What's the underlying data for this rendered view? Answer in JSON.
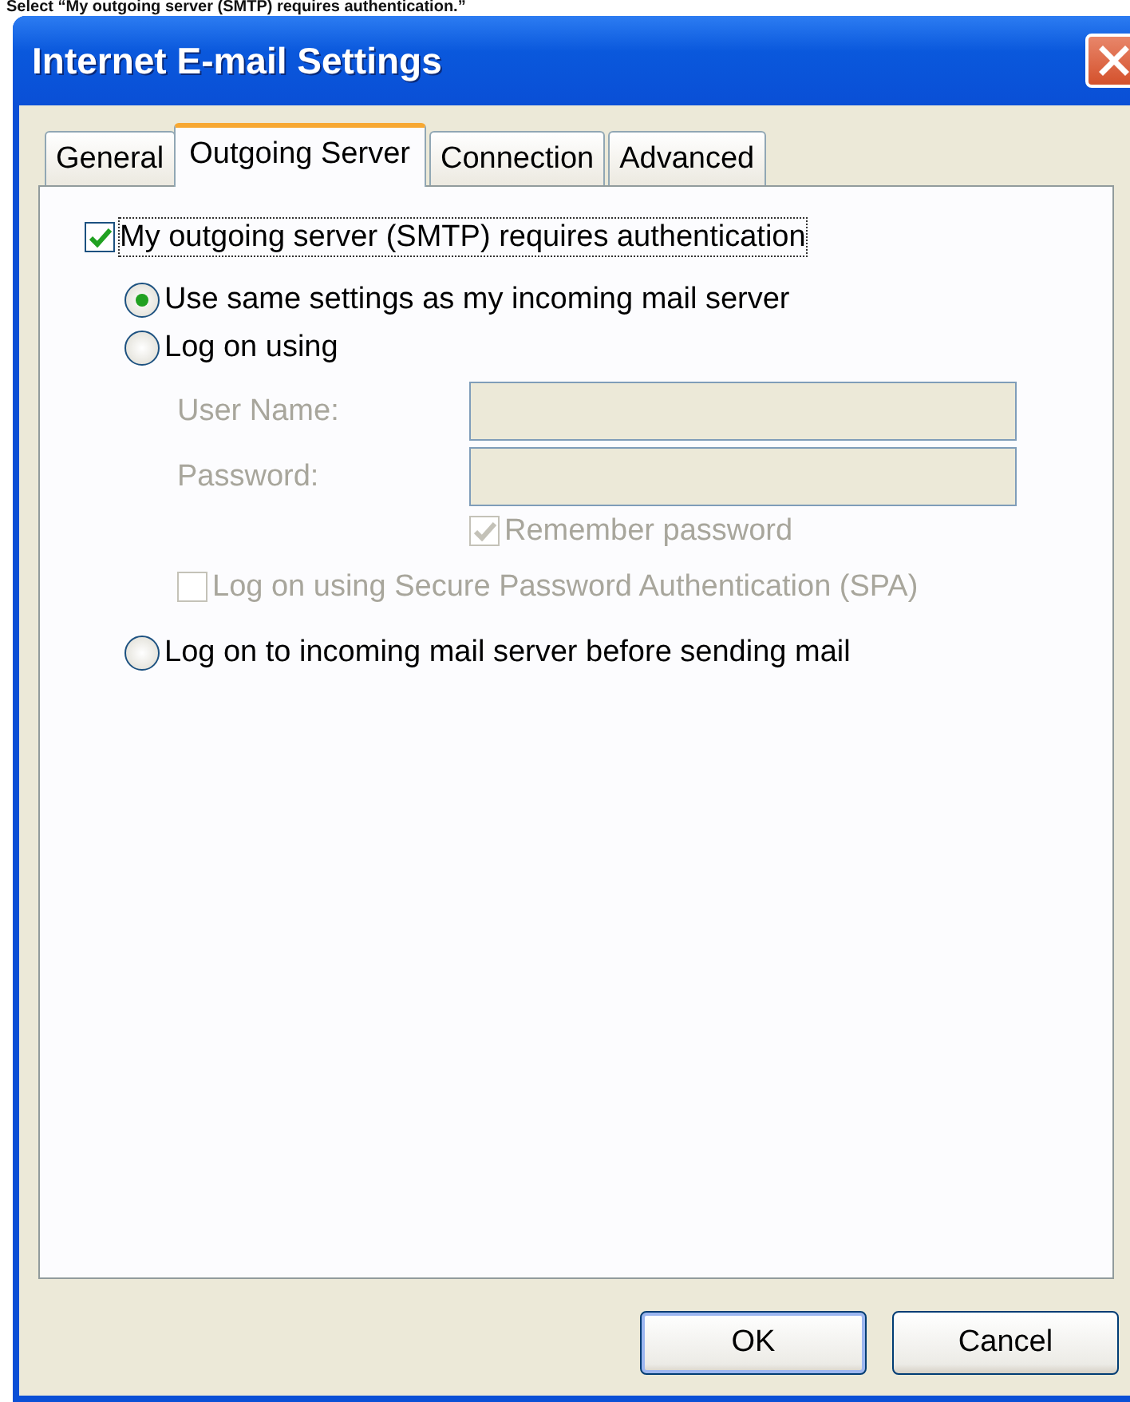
{
  "caption": "Select “My outgoing server (SMTP) requires authentication.”",
  "window": {
    "title": "Internet E-mail Settings"
  },
  "tabs": [
    {
      "label": "General",
      "selected": false
    },
    {
      "label": "Outgoing Server",
      "selected": true
    },
    {
      "label": "Connection",
      "selected": false
    },
    {
      "label": "Advanced",
      "selected": false
    }
  ],
  "auth_checkbox": {
    "label": "My outgoing server (SMTP) requires authentication",
    "checked": true
  },
  "radios": [
    {
      "label": "Use same settings as my incoming mail server",
      "selected": true
    },
    {
      "label": "Log on using",
      "selected": false,
      "details": {
        "fields": [
          {
            "label": "User Name:",
            "disabled": true
          },
          {
            "label": "Password:",
            "disabled": true
          }
        ],
        "remember_password": {
          "label": "Remember password",
          "checked": true,
          "disabled": true
        },
        "spa": {
          "label": "Log on using Secure Password Authentication (SPA)",
          "checked": false,
          "disabled": true
        }
      }
    },
    {
      "label": "Log on to incoming mail server before sending mail",
      "selected": false
    }
  ],
  "buttons": [
    {
      "label": "OK",
      "kind": "default"
    },
    {
      "label": "Cancel",
      "kind": "normal"
    }
  ]
}
